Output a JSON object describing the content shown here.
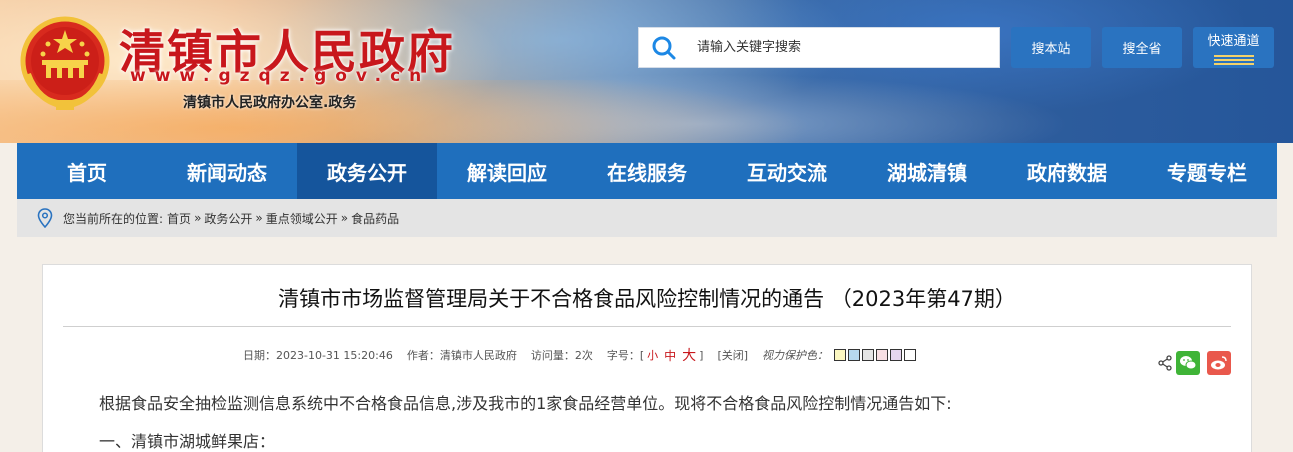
{
  "header": {
    "site_title": "清镇市人民政府",
    "site_url": "www.gzqz.gov.cn",
    "site_subtitle": "清镇市人民政府办公室.政务",
    "search_placeholder": "请输入关键字搜索",
    "btn_search_site": "搜本站",
    "btn_search_province": "搜全省",
    "btn_fast_channel": "快速通道"
  },
  "nav": {
    "items": [
      "首页",
      "新闻动态",
      "政务公开",
      "解读回应",
      "在线服务",
      "互动交流",
      "湖城清镇",
      "政府数据",
      "专题专栏"
    ],
    "active_index": 2
  },
  "breadcrumb": {
    "prefix": "您当前所在的位置:",
    "items": [
      "首页",
      "政务公开",
      "重点领域公开",
      "食品药品"
    ],
    "separator": "»"
  },
  "article": {
    "title": "清镇市市场监督管理局关于不合格食品风险控制情况的通告 （2023年第47期）",
    "meta": {
      "date": "日期：2023-10-31 15:20:46",
      "author": "作者：清镇市人民政府",
      "views": "访问量：2次",
      "font_label": "字号：[",
      "font_small": "小",
      "font_mid": "中",
      "font_big": "大",
      "font_close": "]",
      "close_label": "[关闭]",
      "protect_label": "视力保护色："
    },
    "protect_colors": [
      "#fbf7c1",
      "#b7d9ee",
      "#e5e5e5",
      "#f7dfe3",
      "#e6d6f0",
      "#ffffff"
    ],
    "paragraphs": [
      "根据食品安全抽检监测信息系统中不合格食品信息,涉及我市的1家食品经营单位。现将不合格食品风险控制情况通告如下:",
      "一、清镇市湖城鲜果店："
    ]
  },
  "colors": {
    "nav_bg": "#1f6fbd",
    "nav_active": "#15559c",
    "title_red": "#c8171c",
    "button_blue": "#2a73c0"
  }
}
